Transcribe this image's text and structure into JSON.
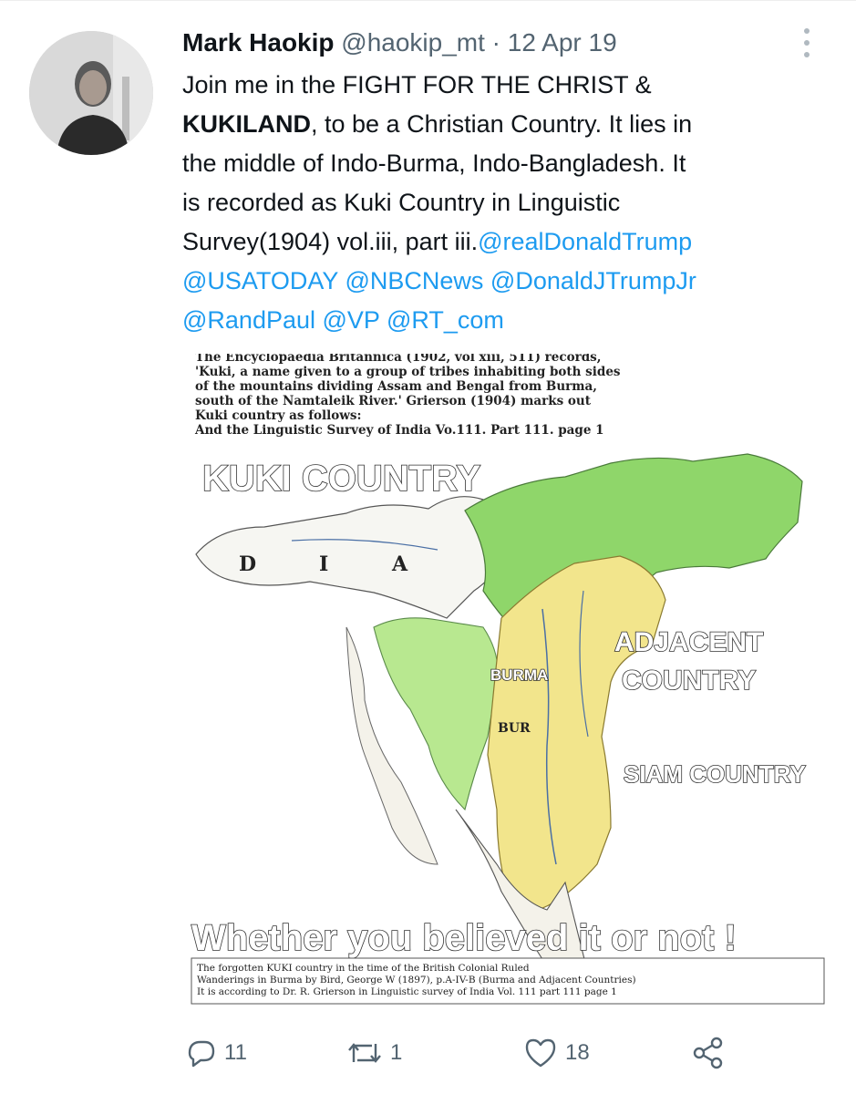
{
  "tweet": {
    "author_name": "Mark Haokip",
    "handle": "@haokip_mt",
    "separator": "·",
    "date": "12 Apr 19",
    "text_lines": [
      {
        "parts": [
          {
            "t": "Join me in the FIGHT FOR THE CHRIST &",
            "k": "plain"
          }
        ]
      },
      {
        "parts": [
          {
            "t": "KUKILAND",
            "k": "bold"
          },
          {
            "t": ", to be a Christian Country. It lies in",
            "k": "plain"
          }
        ]
      },
      {
        "parts": [
          {
            "t": "the middle of Indo-Burma, Indo-Bangladesh. It",
            "k": "plain"
          }
        ]
      },
      {
        "parts": [
          {
            "t": "is recorded as Kuki Country in Linguistic",
            "k": "plain"
          }
        ]
      },
      {
        "parts": [
          {
            "t": "Survey(1904) vol.iii, part iii.",
            "k": "plain"
          },
          {
            "t": "@realDonaldTrump",
            "k": "mention"
          }
        ]
      },
      {
        "parts": [
          {
            "t": "@USATODAY",
            "k": "mention"
          },
          {
            "t": " ",
            "k": "plain"
          },
          {
            "t": "@NBCNews",
            "k": "mention"
          },
          {
            "t": " ",
            "k": "plain"
          },
          {
            "t": "@DonaldJTrumpJr",
            "k": "mention"
          }
        ]
      },
      {
        "parts": [
          {
            "t": "@RandPaul",
            "k": "mention"
          },
          {
            "t": " ",
            "k": "plain"
          },
          {
            "t": "@VP",
            "k": "mention"
          },
          {
            "t": " ",
            "k": "plain"
          },
          {
            "t": "@RT_com",
            "k": "mention"
          }
        ]
      }
    ]
  },
  "media": {
    "top_text": [
      "The Encyclopaedia Britannica (1902, vol xiii, 511) records,",
      "'Kuki, a name given to a group of tribes inhabiting both sides",
      "of the mountains dividing Assam and Bengal from Burma,",
      "south of the Namtaleik River.' Grierson (1904) marks out",
      "Kuki country as follows:",
      "And the Linguistic Survey of India Vo.111. Part 111. page 1"
    ],
    "kuki_label": "KUKI COUNTRY",
    "india_letters": [
      "D",
      "I",
      "A"
    ],
    "burma_label": "BURMA",
    "bur_label": "BUR",
    "adjacent_label_1": "ADJACENT",
    "adjacent_label_2": "COUNTRY",
    "siam_label": "SIAM COUNTRY",
    "believe_label": "Whether you believed it or not !",
    "caption_lines": [
      "The forgotten KUKI country in the time of the British Colonial Ruled",
      "Wanderings in Burma by Bird, George W (1897), p.A-IV-B (Burma and Adjacent Countries)",
      "It is according to Dr. R. Grierson in Linguistic survey of India Vol. 111 part 111 page 1"
    ],
    "colors": {
      "green": "#8fd66a",
      "light_green": "#b8e890",
      "yellow": "#f2e58c",
      "ink": "#333333"
    }
  },
  "actions": {
    "replies": "11",
    "retweets": "1",
    "likes": "18"
  },
  "colors": {
    "text": "#0f1419",
    "secondary": "#536471",
    "link": "#1d9bf0"
  }
}
